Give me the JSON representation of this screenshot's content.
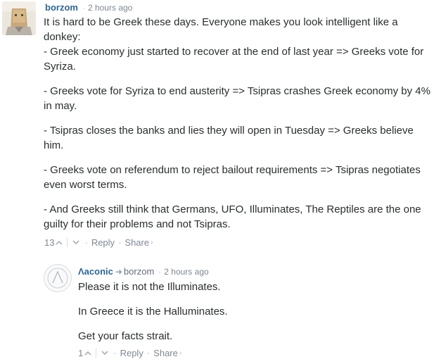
{
  "comments": [
    {
      "author": "borzom",
      "time": "2 hours ago",
      "paragraphs": [
        "It is hard to be Greek these days. Everyone makes you look intelligent like a donkey:\n- Greek economy just started to recover at the end of last year => Greeks vote for Syriza.",
        "- Greeks vote for Syriza to end austerity => Tsipras crashes Greek economy by 4% in may.",
        "- Tsipras closes the banks and lies they will open in Tuesday => Greeks believe him.",
        "- Greeks vote on referendum to reject bailout requirements => Tsipras negotiates even worst terms.",
        "- And Greeks still think that Germans, UFO, Illuminates, The Reptiles are the one guilty for their problems and not Tsipras."
      ],
      "votes": "13",
      "reply_label": "Reply",
      "share_label": "Share"
    },
    {
      "author": "Λaconic",
      "reply_to": "borzom",
      "time": "2 hours ago",
      "paragraphs": [
        "Please it is not the Illuminates.",
        "In Greece it is the Halluminates.",
        "Get your facts strait."
      ],
      "votes": "1",
      "reply_label": "Reply",
      "share_label": "Share"
    }
  ],
  "icons": {
    "upvote": "chevron-up",
    "downvote": "chevron-down",
    "reply_arrow": "reply-arrow",
    "share_caret": "chevron-right"
  },
  "colors": {
    "author": "#2e6797",
    "meta": "#7f8894",
    "text": "#2a2e2e"
  }
}
